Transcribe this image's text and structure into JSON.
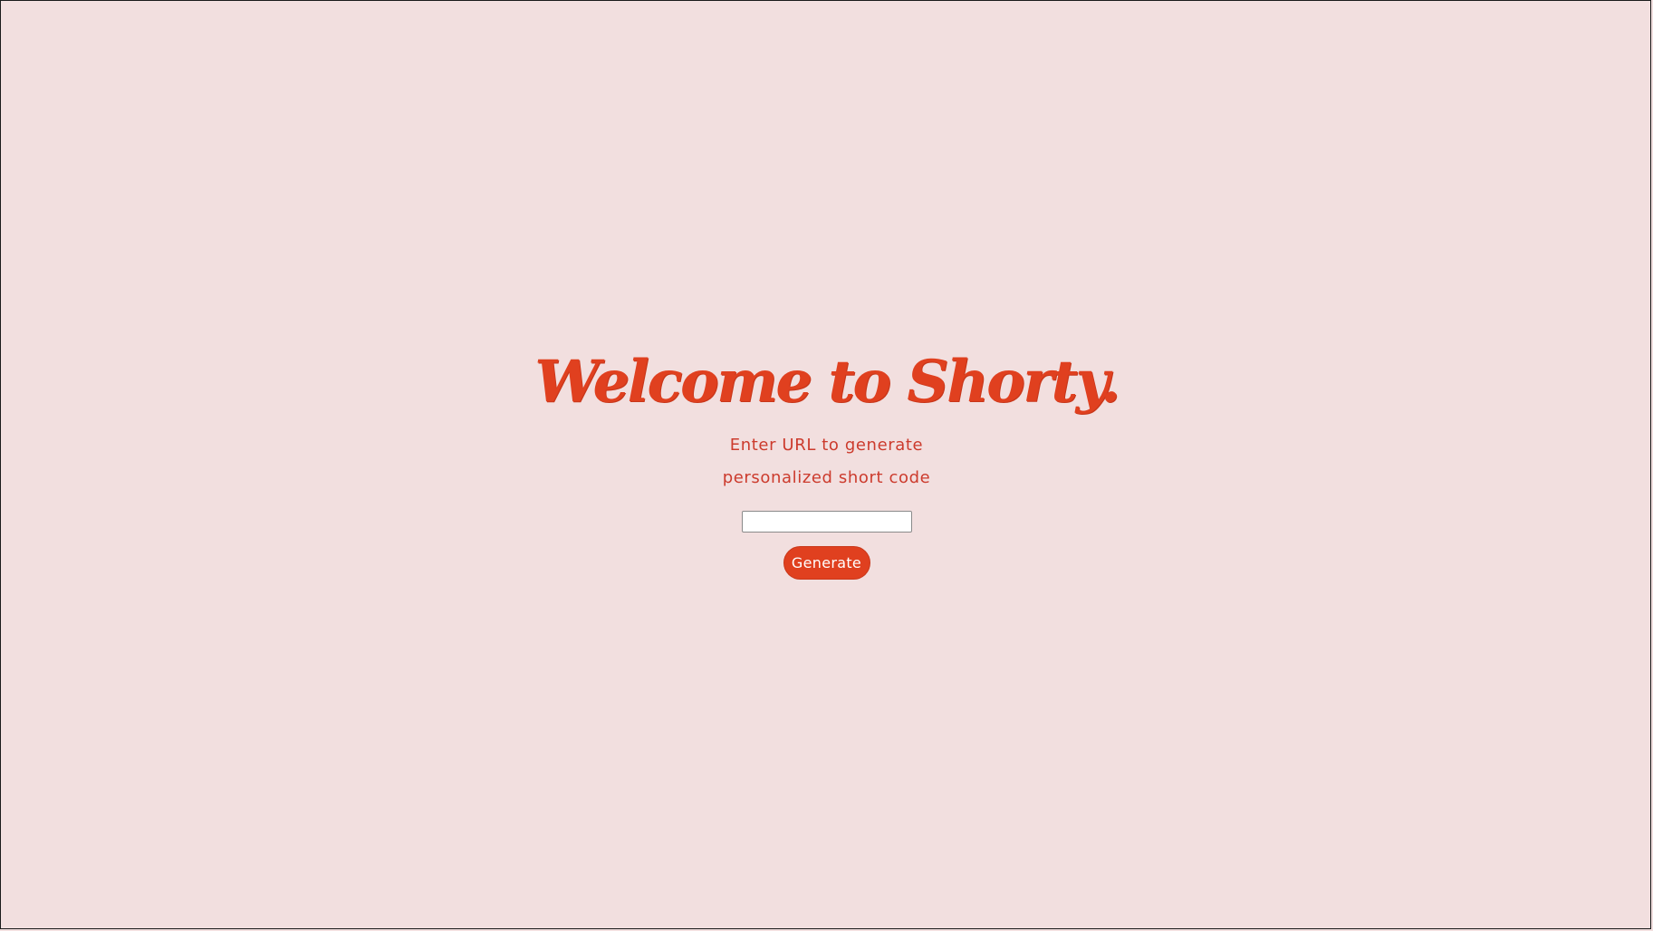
{
  "hero": {
    "title": "Welcome to Shorty.",
    "description_lines": [
      "Enter URL to generate",
      "personalized short code"
    ]
  },
  "form": {
    "url_input": {
      "value": "",
      "placeholder": ""
    },
    "generate_label": "Generate"
  },
  "colors": {
    "background": "#f2dfdf",
    "accent": "#e0401f",
    "text": "#cc3b2d",
    "button_text": "#ffffff"
  }
}
